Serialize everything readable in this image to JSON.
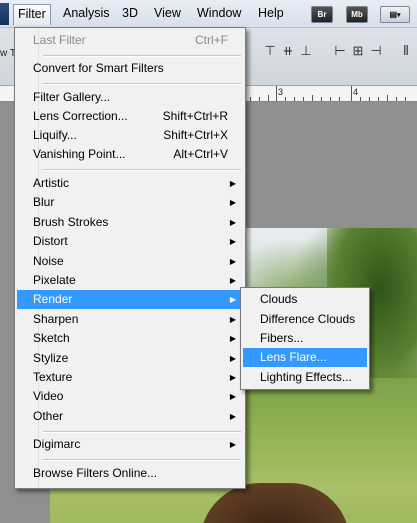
{
  "menubar": {
    "items": [
      "Filter",
      "Analysis",
      "3D",
      "View",
      "Window",
      "Help"
    ],
    "active": "Filter",
    "buttons": [
      "Br",
      "Mb"
    ]
  },
  "optionsbar": {
    "fragment": "w T"
  },
  "ruler": {
    "labels": [
      "3",
      "4"
    ]
  },
  "filter_menu": {
    "rows": [
      {
        "label": "Last Filter",
        "shortcut": "Ctrl+F",
        "disabled": true
      },
      {
        "label": "Convert for Smart Filters"
      },
      {
        "label": "Filter Gallery..."
      },
      {
        "label": "Lens Correction...",
        "shortcut": "Shift+Ctrl+R"
      },
      {
        "label": "Liquify...",
        "shortcut": "Shift+Ctrl+X"
      },
      {
        "label": "Vanishing Point...",
        "shortcut": "Alt+Ctrl+V"
      },
      {
        "label": "Artistic",
        "submenu": true
      },
      {
        "label": "Blur",
        "submenu": true
      },
      {
        "label": "Brush Strokes",
        "submenu": true
      },
      {
        "label": "Distort",
        "submenu": true
      },
      {
        "label": "Noise",
        "submenu": true
      },
      {
        "label": "Pixelate",
        "submenu": true
      },
      {
        "label": "Render",
        "submenu": true,
        "highlighted": true
      },
      {
        "label": "Sharpen",
        "submenu": true
      },
      {
        "label": "Sketch",
        "submenu": true
      },
      {
        "label": "Stylize",
        "submenu": true
      },
      {
        "label": "Texture",
        "submenu": true
      },
      {
        "label": "Video",
        "submenu": true
      },
      {
        "label": "Other",
        "submenu": true
      },
      {
        "label": "Digimarc",
        "submenu": true
      },
      {
        "label": "Browse Filters Online..."
      }
    ]
  },
  "render_submenu": {
    "items": [
      "Clouds",
      "Difference Clouds",
      "Fibers...",
      "Lens Flare...",
      "Lighting Effects..."
    ],
    "highlighted": "Lens Flare..."
  },
  "colors": {
    "highlight": "#3399ff",
    "menu_bg": "#f1f1f1",
    "menubar_bg": "#dde4ee"
  }
}
